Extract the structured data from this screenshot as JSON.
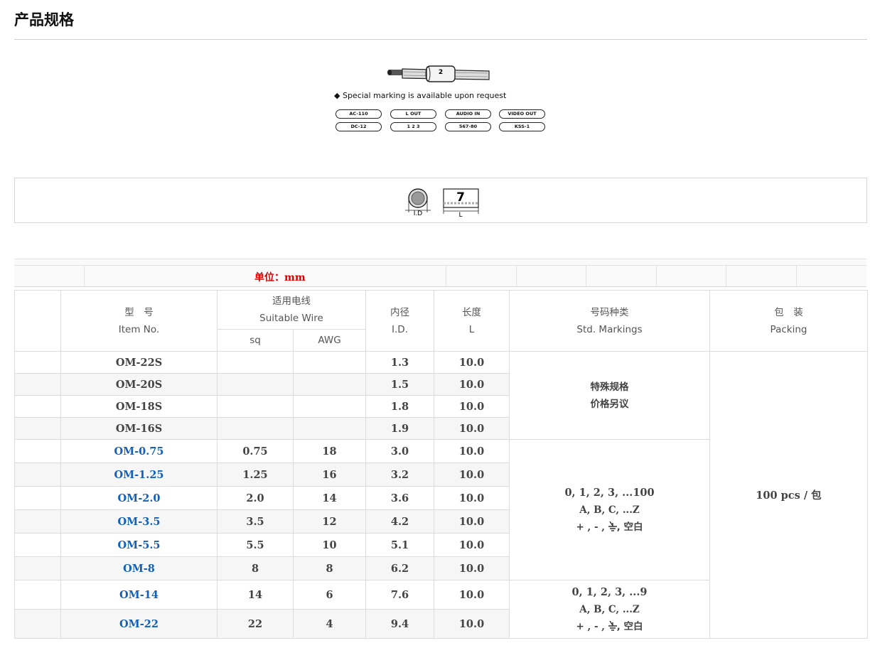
{
  "page": {
    "title": "产品规格"
  },
  "illustration": {
    "sleeve_number": "2",
    "special_note": "◆ Special marking is available upon request",
    "labels_row1": [
      "AC-110",
      "L OUT",
      "AUDIO IN",
      "VIDEO OUT"
    ],
    "labels_row2": [
      "DC-12",
      "1 2 3",
      "567-80",
      "KSS-1"
    ]
  },
  "dimension": {
    "digit": "7",
    "id_label": "I.D",
    "l_label": "L"
  },
  "unit": {
    "text": "单位：mm"
  },
  "table": {
    "headers": {
      "item_cn": "型　号",
      "item_en": "Item No.",
      "wire_cn": "适用电线",
      "wire_en": "Suitable Wire",
      "sq": "sq",
      "awg": "AWG",
      "id_cn": "内径",
      "id_en": "I.D.",
      "len_cn": "长度",
      "len_en": "L",
      "mark_cn": "号码种类",
      "mark_en": "Std. Markings",
      "pack_cn": "包　装",
      "pack_en": "Packing"
    },
    "rows": [
      {
        "item": "OM-22S",
        "sq": "",
        "awg": "",
        "id": "1.3",
        "l": "10.0"
      },
      {
        "item": "OM-20S",
        "sq": "",
        "awg": "",
        "id": "1.5",
        "l": "10.0"
      },
      {
        "item": "OM-18S",
        "sq": "",
        "awg": "",
        "id": "1.8",
        "l": "10.0"
      },
      {
        "item": "OM-16S",
        "sq": "",
        "awg": "",
        "id": "1.9",
        "l": "10.0"
      },
      {
        "item": "OM-0.75",
        "sq": "0.75",
        "awg": "18",
        "id": "3.0",
        "l": "10.0"
      },
      {
        "item": "OM-1.25",
        "sq": "1.25",
        "awg": "16",
        "id": "3.2",
        "l": "10.0"
      },
      {
        "item": "OM-2.0",
        "sq": "2.0",
        "awg": "14",
        "id": "3.6",
        "l": "10.0"
      },
      {
        "item": "OM-3.5",
        "sq": "3.5",
        "awg": "12",
        "id": "4.2",
        "l": "10.0"
      },
      {
        "item": "OM-5.5",
        "sq": "5.5",
        "awg": "10",
        "id": "5.1",
        "l": "10.0"
      },
      {
        "item": "OM-8",
        "sq": "8",
        "awg": "8",
        "id": "6.2",
        "l": "10.0"
      },
      {
        "item": "OM-14",
        "sq": "14",
        "awg": "6",
        "id": "7.6",
        "l": "10.0"
      },
      {
        "item": "OM-22",
        "sq": "22",
        "awg": "4",
        "id": "9.4",
        "l": "10.0"
      }
    ],
    "markings_special": {
      "line1": "特殊规格",
      "line2": "价格另议"
    },
    "markings_a": {
      "line1": "0, 1, 2, 3, ...100",
      "line2": "A, B, C, ...Z",
      "line3a": "+ , - ,",
      "line3b": ", 空白"
    },
    "markings_b": {
      "line1": "0, 1, 2, 3, ...9",
      "line2": "A, B, C, ...Z",
      "line3a": "+ , - ,",
      "line3b": ", 空白"
    },
    "packing": "100 pcs / 包"
  },
  "colors": {
    "accent_red": "#dd0000",
    "item_blue": "#1460b8"
  }
}
